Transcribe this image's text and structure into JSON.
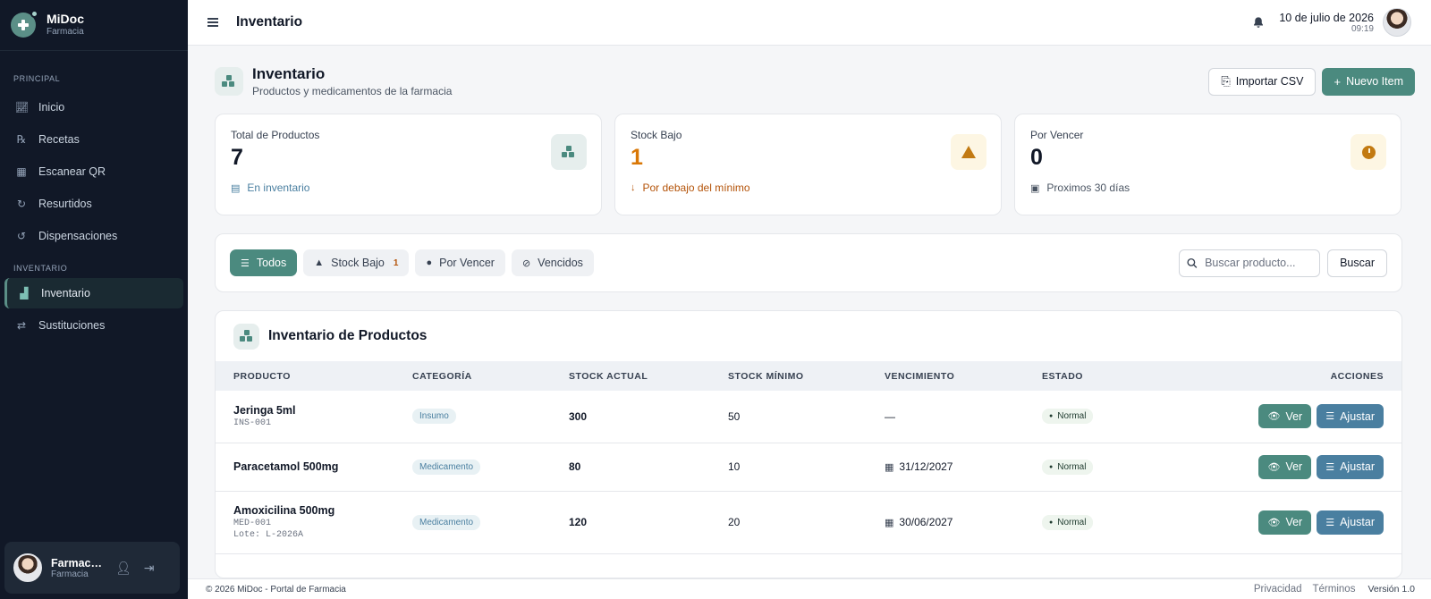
{
  "brand": {
    "name": "MiDoc",
    "subtitle": "Farmacia"
  },
  "sidebar": {
    "sections": [
      {
        "label": "PRINCIPAL",
        "items": [
          {
            "label": "Inicio",
            "icon": "chart-line-icon"
          },
          {
            "label": "Recetas",
            "icon": "prescription-icon"
          },
          {
            "label": "Escanear QR",
            "icon": "qr-code-icon"
          },
          {
            "label": "Resurtidos",
            "icon": "refresh-icon"
          },
          {
            "label": "Dispensaciones",
            "icon": "history-icon"
          }
        ]
      },
      {
        "label": "INVENTARIO",
        "items": [
          {
            "label": "Inventario",
            "icon": "boxes-icon",
            "active": true
          },
          {
            "label": "Sustituciones",
            "icon": "swap-icon"
          }
        ]
      }
    ],
    "user": {
      "name": "Farmacéutico",
      "role": "Farmacia"
    }
  },
  "header": {
    "title": "Inventario",
    "date": "10 de julio de 2026",
    "time": "09:19"
  },
  "page": {
    "title": "Inventario",
    "subtitle": "Productos y medicamentos de la farmacia",
    "import_label": "Importar CSV",
    "new_label": "Nuevo Item"
  },
  "stats": [
    {
      "label": "Total de Productos",
      "value": "7",
      "foot": "En inventario"
    },
    {
      "label": "Stock Bajo",
      "value": "1",
      "foot": "Por debajo del mínimo"
    },
    {
      "label": "Por Vencer",
      "value": "0",
      "foot": "Proximos 30 días"
    }
  ],
  "filters": {
    "chips": [
      {
        "label": "Todos"
      },
      {
        "label": "Stock Bajo",
        "badge": "1"
      },
      {
        "label": "Por Vencer"
      },
      {
        "label": "Vencidos"
      }
    ],
    "search_placeholder": "Buscar producto...",
    "search_button": "Buscar"
  },
  "table": {
    "title": "Inventario de Productos",
    "columns": [
      "PRODUCTO",
      "CATEGORÍA",
      "STOCK ACTUAL",
      "STOCK MÍNIMO",
      "VENCIMIENTO",
      "ESTADO",
      "ACCIONES"
    ],
    "rows": [
      {
        "name": "Jeringa 5ml",
        "code": "INS-001",
        "lot": "",
        "category": "Insumo",
        "stock": "300",
        "min": "50",
        "expiry": "—",
        "status": "Normal"
      },
      {
        "name": "Paracetamol 500mg",
        "code": "",
        "lot": "",
        "category": "Medicamento",
        "stock": "80",
        "min": "10",
        "expiry": "31/12/2027",
        "status": "Normal"
      },
      {
        "name": "Amoxicilina 500mg",
        "code": "MED-001",
        "lot": "Lote: L-2026A",
        "category": "Medicamento",
        "stock": "120",
        "min": "20",
        "expiry": "30/06/2027",
        "status": "Normal"
      }
    ],
    "view_label": "Ver",
    "adjust_label": "Ajustar"
  },
  "footer": {
    "copyright": "© 2026 MiDoc - Portal de Farmacia",
    "privacy": "Privacidad",
    "terms": "Términos",
    "version": "Versión 1.0"
  }
}
